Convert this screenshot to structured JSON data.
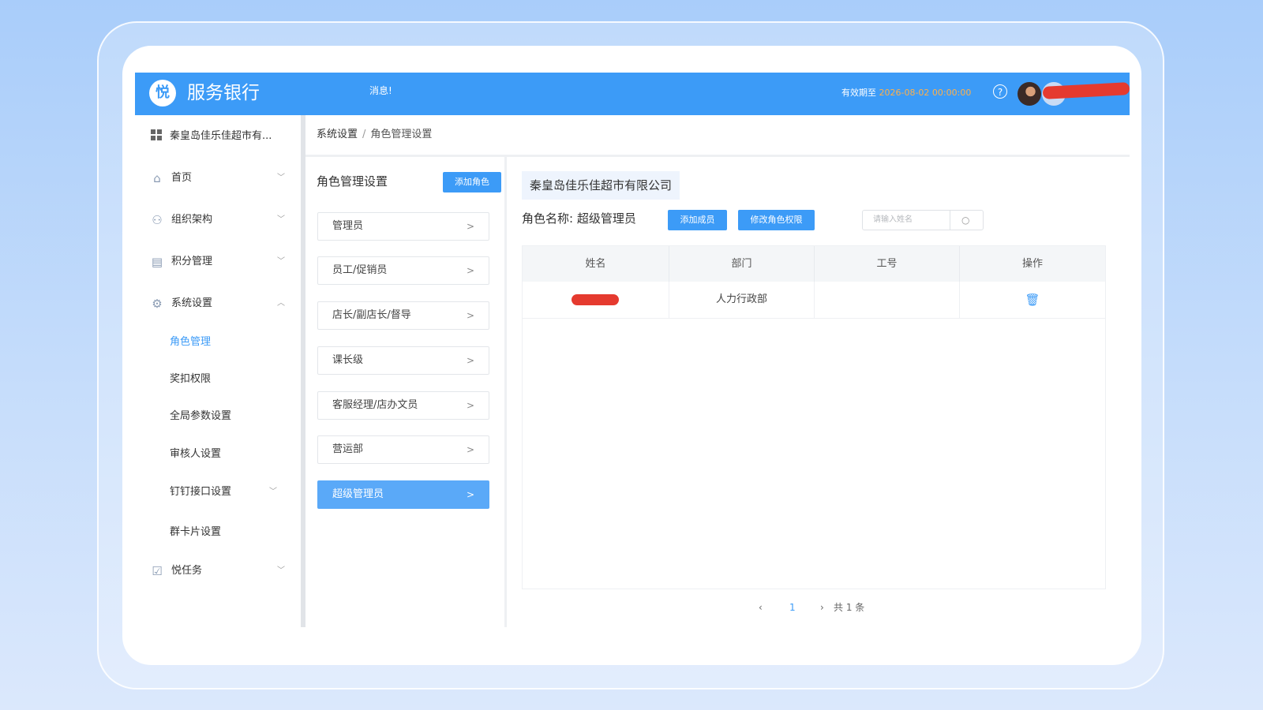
{
  "header": {
    "logo_char": "悦",
    "app_title": "服务银行",
    "notice": "消息!",
    "validity_label": "有效期至",
    "validity_date": "2026-08-02 00:00:00",
    "help_char": "?"
  },
  "sidebar": {
    "company": "秦皇岛佳乐佳超市有...",
    "items": [
      {
        "label": "首页",
        "icon": "home-icon"
      },
      {
        "label": "组织架构",
        "icon": "users-icon"
      },
      {
        "label": "积分管理",
        "icon": "database-icon"
      },
      {
        "label": "系统设置",
        "icon": "settings-icon"
      }
    ],
    "sub_items": [
      "角色管理",
      "奖扣权限",
      "全局参数设置",
      "审核人设置",
      "钉钉接口设置",
      "群卡片设置"
    ],
    "task_item": {
      "label": "悦任务",
      "icon": "task-icon"
    }
  },
  "breadcrumb": {
    "parent": "系统设置",
    "separator": "/",
    "current": "角色管理设置"
  },
  "roles_panel": {
    "title": "角色管理设置",
    "add_button": "添加角色",
    "roles": [
      "管理员",
      "员工/促销员",
      "店长/副店长/督导",
      "课长级",
      "客服经理/店办文员",
      "营运部",
      "超级管理员"
    ],
    "active_role": "超级管理员"
  },
  "detail": {
    "company": "秦皇岛佳乐佳超市有限公司",
    "role_label": "角色名称:",
    "role_value": "超级管理员",
    "add_member_button": "添加成员",
    "edit_permission_button": "修改角色权限",
    "search_placeholder": "请输入姓名",
    "table": {
      "columns": [
        "姓名",
        "部门",
        "工号",
        "操作"
      ],
      "rows": [
        {
          "name": "",
          "department": "人力行政部",
          "employee_id": ""
        }
      ]
    },
    "pagination": {
      "prev": "‹",
      "page": "1",
      "next": "›",
      "total": "共 1 条"
    }
  },
  "colors": {
    "primary": "#3c9bf7",
    "validity_date": "#ffb04a",
    "redaction": "#e53a2f"
  }
}
